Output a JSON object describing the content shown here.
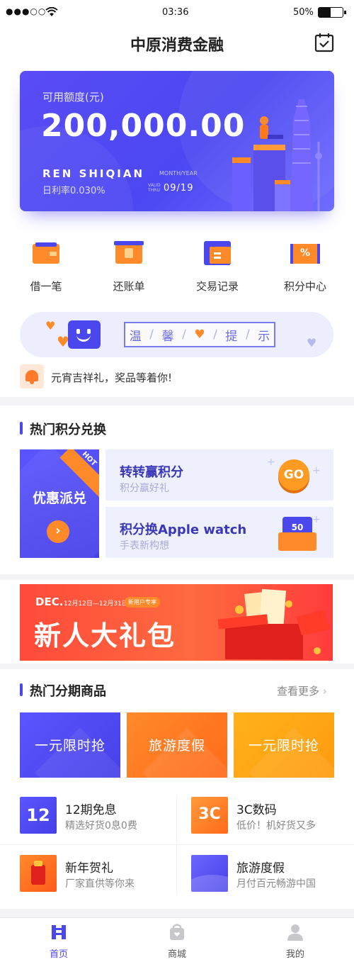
{
  "status": {
    "carrier_dots": "●●●○○",
    "time": "03:36",
    "battery": "50%"
  },
  "nav": {
    "title": "中原消费金融",
    "calendar_icon": "calendar-check-icon"
  },
  "card": {
    "label": "可用额度(元)",
    "amount": "200,000.00",
    "name": "REN SHIQIAN",
    "rate": "日利率0.030%",
    "month_year": "MONTH/YEAR",
    "valid": "VALID",
    "thru": "THRU",
    "expiry": "09/19"
  },
  "quick": [
    {
      "label": "借一笔",
      "icon": "wallet-icon"
    },
    {
      "label": "还账单",
      "icon": "repay-icon"
    },
    {
      "label": "交易记录",
      "icon": "record-icon"
    },
    {
      "label": "积分中心",
      "icon": "points-ticket-icon"
    }
  ],
  "tips": {
    "chars": [
      "温",
      "馨",
      "提",
      "示"
    ],
    "heart": "♥"
  },
  "notice": {
    "text": "元宵吉祥礼，奖品等着你!"
  },
  "points": {
    "title": "热门积分兑换",
    "big": {
      "title": "优惠派兑",
      "badge": "HOT"
    },
    "items": [
      {
        "title": "转转赢积分",
        "sub": "积分赢好礼",
        "badge": "GO"
      },
      {
        "title": "积分换Apple watch",
        "sub": "手表新构想",
        "badge": "50"
      }
    ]
  },
  "banner": {
    "dec": "DEC.",
    "dates": "12月12日—12月31日",
    "tag": "新用户专享",
    "title": "新人大礼包"
  },
  "goods": {
    "title": "热门分期商品",
    "more": "查看更多",
    "tiles": [
      "一元限时抢",
      "旅游度假",
      "一元限时抢"
    ],
    "products": [
      {
        "title": "12期免息",
        "sub": "精选好货0息0费",
        "icon_text": "12"
      },
      {
        "title": "3C数码",
        "sub": "低价！机好货又多",
        "icon_text": "3C"
      },
      {
        "title": "新年贺礼",
        "sub": "厂家直供等你来"
      },
      {
        "title": "旅游度假",
        "sub": "月付百元畅游中国"
      }
    ]
  },
  "tabs": [
    {
      "label": "首页",
      "active": true
    },
    {
      "label": "商城",
      "active": false
    },
    {
      "label": "我的",
      "active": false
    }
  ],
  "colors": {
    "primary": "#4a47ef",
    "orange": "#ff8a2a",
    "red": "#ff4a3a"
  }
}
